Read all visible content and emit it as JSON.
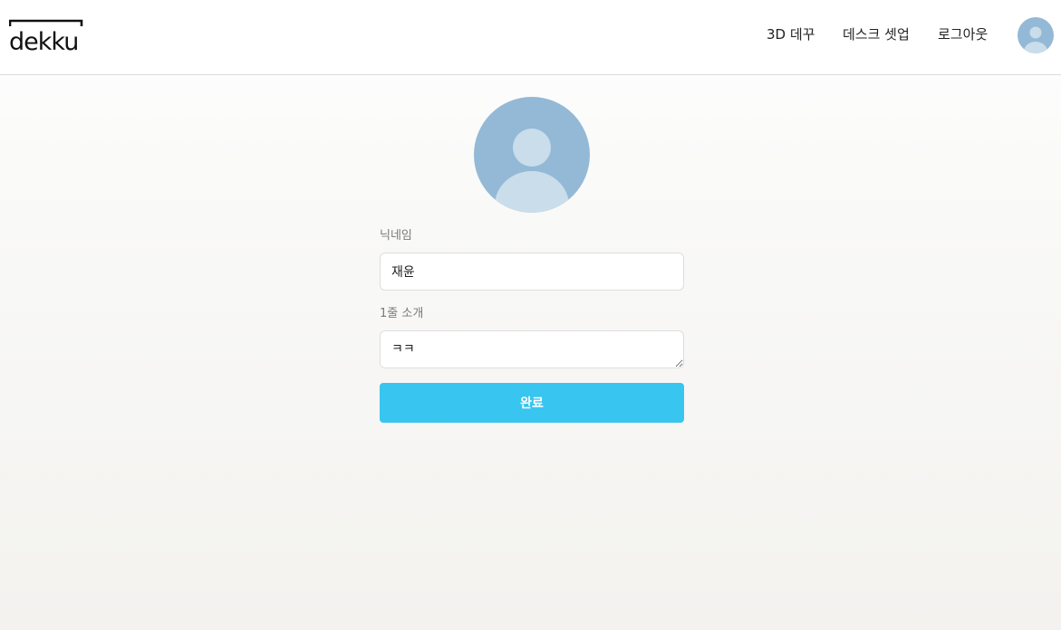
{
  "header": {
    "logo_text": "dekku",
    "nav": [
      {
        "label": "3D 데꾸"
      },
      {
        "label": "데스크 셋업"
      },
      {
        "label": "로그아웃"
      }
    ]
  },
  "profile_form": {
    "nickname": {
      "label": "닉네임",
      "value": "재윤"
    },
    "bio": {
      "label": "1줄 소개",
      "value": "ㅋㅋ"
    },
    "submit_label": "완료"
  },
  "colors": {
    "accent": "#38c5ef",
    "avatar_bg": "#94b9d6",
    "avatar_fg": "#c9ddea"
  }
}
